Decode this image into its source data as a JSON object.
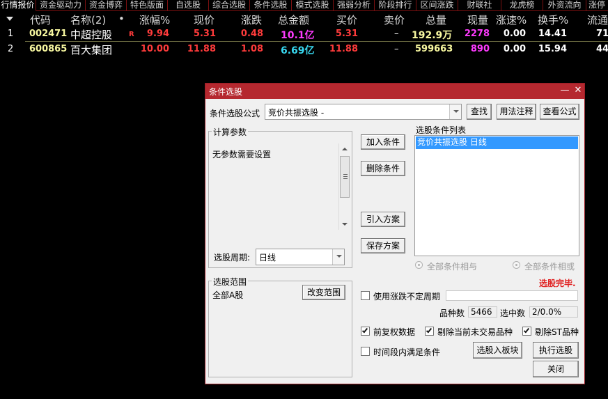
{
  "tabs": [
    "行情报价",
    "资金驱动力",
    "资金博弈",
    "特色版面",
    "自选股",
    "综合选股",
    "条件选股",
    "模式选股",
    "强弱分析",
    "阶段排行",
    "区间涨跌",
    "财联社",
    "龙虎榜",
    "外资流向",
    "涨停"
  ],
  "table": {
    "headers": {
      "code": "代码",
      "name": "名称(2)",
      "dot": "•",
      "change_pct": "涨幅%",
      "price": "现价",
      "change": "涨跌",
      "amount": "总金额",
      "bid": "买价",
      "ask": "卖价",
      "volume": "总量",
      "cur_vol": "现量",
      "speed": "涨速%",
      "turnover": "换手%",
      "float": "流通"
    },
    "rows": [
      {
        "idx": "1",
        "code": "002471",
        "name": "中超控股",
        "flag": "R",
        "change_pct": "9.94",
        "price": "5.31",
        "change": "0.48",
        "amount": "10.1亿",
        "bid": "5.31",
        "ask": "–",
        "volume": "192.9万",
        "cur_vol": "2278",
        "speed": "0.00",
        "turnover": "14.41",
        "float": "71."
      },
      {
        "idx": "2",
        "code": "600865",
        "name": "百大集团",
        "flag": "",
        "change_pct": "10.00",
        "price": "11.88",
        "change": "1.08",
        "amount": "6.69亿",
        "bid": "11.88",
        "ask": "–",
        "volume": "599663",
        "cur_vol": "890",
        "speed": "0.00",
        "turnover": "15.94",
        "float": "44."
      }
    ]
  },
  "dialog": {
    "title": "条件选股",
    "minimize": "—",
    "close": "✕",
    "formula_label": "条件选股公式",
    "formula_value": "竞价共振选股  -",
    "btn_find": "查找",
    "btn_usage": "用法注释",
    "btn_view": "查看公式",
    "calc_params_title": "计算参数",
    "no_params": "无参数需要设置",
    "period_label": "选股周期:",
    "period_value": "日线",
    "btn_add": "加入条件",
    "btn_delete": "删除条件",
    "btn_import": "引入方案",
    "btn_save": "保存方案",
    "list_title": "选股条件列表",
    "list_items": [
      "竞价共振选股  日线"
    ],
    "radio_and": "全部条件相与",
    "radio_or": "全部条件相或",
    "status": "选股完毕.",
    "range_title": "选股范围",
    "range_value": "全部A股",
    "btn_change_range": "改变范围",
    "chk_period": "使用涨跌不定周期",
    "count_label": "品种数",
    "count_value": "5466",
    "selected_label": "选中数",
    "selected_value": "2/0.0%",
    "chk_fq": "前复权数据",
    "chk_untraded": "剔除当前未交易品种",
    "chk_st": "剔除ST品种",
    "chk_timespan": "时间段内满足条件",
    "btn_to_block": "选股入板块",
    "btn_execute": "执行选股",
    "btn_close": "关闭"
  },
  "colors": {
    "dialog_title_bg": "#b5282f",
    "status_red": "#e02020",
    "list_highlight": "#3399ff"
  }
}
